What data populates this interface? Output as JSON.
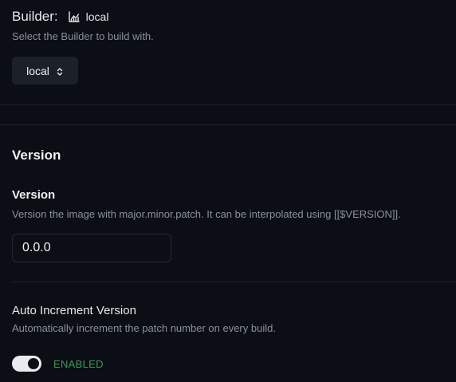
{
  "builder": {
    "label": "Builder:",
    "current": "local",
    "description": "Select the Builder to build with.",
    "select_value": "local",
    "icon": "chart-icon"
  },
  "version_section": {
    "title": "Version",
    "field": {
      "title": "Version",
      "description": "Version the image with major.minor.patch. It can be interpolated using [[$VERSION]].",
      "value": "0.0.0"
    },
    "auto_increment": {
      "title": "Auto Increment Version",
      "description": "Automatically increment the patch number on every build.",
      "enabled": true,
      "status_label": "ENABLED",
      "status_color": "#3f9a55"
    }
  }
}
